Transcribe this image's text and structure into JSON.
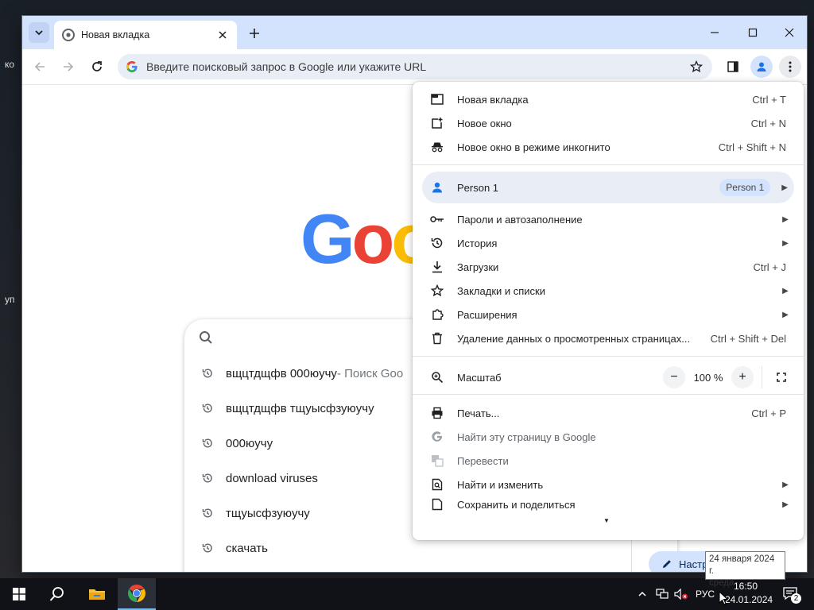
{
  "desktop": {
    "fragment_top": "ко",
    "fragment_mid": "уп"
  },
  "tab": {
    "title": "Новая вкладка"
  },
  "omnibox": {
    "placeholder": "Введите поисковый запрос в Google или укажите URL"
  },
  "ntp": {
    "logo_letters": [
      "G",
      "o",
      "o"
    ],
    "suggestions": [
      {
        "text": "вщцтдщфв 000юучу",
        "extra": " - Поиск Goo"
      },
      {
        "text": "вщцтдщфв тщуысфзуюучу",
        "extra": ""
      },
      {
        "text": "000юучу",
        "extra": ""
      },
      {
        "text": "download viruses",
        "extra": ""
      },
      {
        "text": "тщуысфзуюучу",
        "extra": ""
      },
      {
        "text": "скачать",
        "extra": ""
      }
    ],
    "customize_label": "Настроить Chrome"
  },
  "menu": {
    "new_tab": {
      "label": "Новая вкладка",
      "shortcut": "Ctrl + T"
    },
    "new_window": {
      "label": "Новое окно",
      "shortcut": "Ctrl + N"
    },
    "incognito": {
      "label": "Новое окно в режиме инкогнито",
      "shortcut": "Ctrl + Shift + N"
    },
    "profile": {
      "name": "Person 1",
      "chip": "Person 1"
    },
    "passwords": {
      "label": "Пароли и автозаполнение"
    },
    "history": {
      "label": "История"
    },
    "downloads": {
      "label": "Загрузки",
      "shortcut": "Ctrl + J"
    },
    "bookmarks": {
      "label": "Закладки и списки"
    },
    "extensions": {
      "label": "Расширения"
    },
    "clear_data": {
      "label": "Удаление данных о просмотренных страницах...",
      "shortcut": "Ctrl + Shift + Del"
    },
    "zoom": {
      "label": "Масштаб",
      "minus": "−",
      "value": "100 %",
      "plus": "+"
    },
    "print": {
      "label": "Печать...",
      "shortcut": "Ctrl + P"
    },
    "find_google": {
      "label": "Найти эту страницу в Google"
    },
    "translate": {
      "label": "Перевести"
    },
    "find_edit": {
      "label": "Найти и изменить"
    },
    "save_share": {
      "label": "Сохранить и поделиться"
    }
  },
  "tooltip": {
    "line1": "24 января 2024 г.",
    "line2": "среда"
  },
  "taskbar": {
    "lang": "РУС",
    "time": "16:50",
    "date": "24.01.2024",
    "notifications": "2"
  },
  "colors": {
    "accent": "#1a73e8",
    "titlebar": "#d3e3fd",
    "google_blue": "#4285f4",
    "google_red": "#ea4335",
    "google_yellow": "#fbbc05",
    "google_green": "#34a853"
  }
}
